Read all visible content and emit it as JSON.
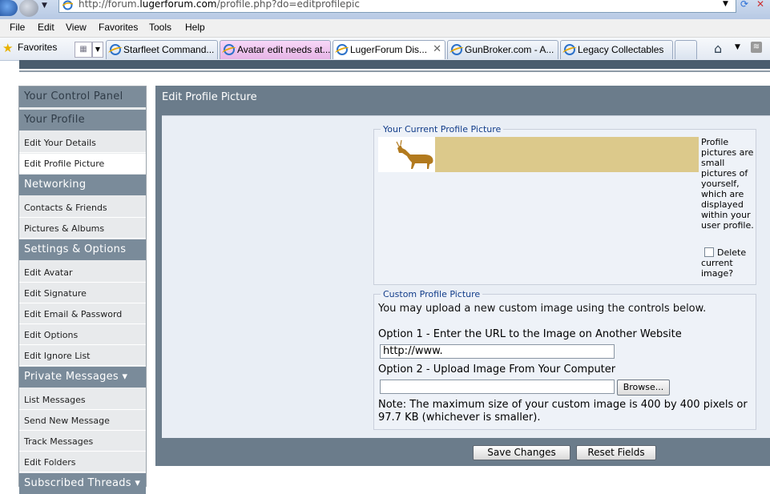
{
  "browser": {
    "url_prefix": "http://forum.",
    "url_domain": "lugerforum.com",
    "url_path": "/profile.php?do=editprofilepic",
    "menu": [
      "File",
      "Edit",
      "View",
      "Favorites",
      "Tools",
      "Help"
    ],
    "favorites_label": "Favorites",
    "tabs": [
      {
        "label": "Starfleet Command...",
        "color": "#dfe7f2"
      },
      {
        "label": "Avatar edit needs at...",
        "color": "#f0c8f0"
      },
      {
        "label": "LugerForum Dis...",
        "color": "#ffffff",
        "active": true
      },
      {
        "label": "GunBroker.com - A...",
        "color": "#dfe7f2"
      },
      {
        "label": "Legacy Collectables",
        "color": "#dfe7f2"
      }
    ]
  },
  "sidebar": {
    "control_panel": "Your Control Panel",
    "your_profile": "Your Profile",
    "edit_details": "Edit Your Details",
    "edit_picture": "Edit Profile Picture",
    "networking": "Networking",
    "contacts": "Contacts & Friends",
    "pictures_albums": "Pictures & Albums",
    "settings": "Settings & Options",
    "edit_avatar": "Edit Avatar",
    "edit_signature": "Edit Signature",
    "edit_email": "Edit Email & Password",
    "edit_options": "Edit Options",
    "edit_ignore": "Edit Ignore List",
    "private_messages": "Private Messages",
    "list_messages": "List Messages",
    "send_message": "Send New Message",
    "track_messages": "Track Messages",
    "edit_folders": "Edit Folders",
    "subscribed_threads": "Subscribed Threads"
  },
  "main": {
    "title": "Edit Profile Picture",
    "current_legend": "Your Current Profile Picture",
    "picture_description": "Profile pictures are small pictures of yourself, which are displayed within your user profile.",
    "delete_label": "Delete current image?",
    "delete_checked": false,
    "custom_legend": "Custom Profile Picture",
    "upload_intro": "You may upload a new custom image using the controls below.",
    "option1_label": "Option 1 - Enter the URL to the Image on Another Website",
    "url_value": "http://www.",
    "option2_label": "Option 2 - Upload Image From Your Computer",
    "browse_label": "Browse...",
    "note": "Note: The maximum size of your custom image is 400 by 400 pixels or 97.7 KB (whichever is smaller).",
    "save_label": "Save Changes",
    "reset_label": "Reset Fields"
  },
  "colors": {
    "sidebar_header": "#7a8b9a",
    "panel": "#6b7c8b",
    "picture_fill": "#dcc98b",
    "legend_text": "#123d8a"
  }
}
